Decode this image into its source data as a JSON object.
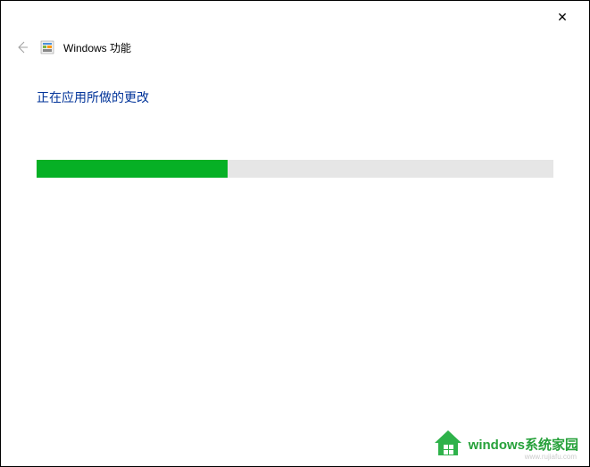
{
  "titlebar": {
    "close_symbol": "✕"
  },
  "header": {
    "title": "Windows 功能"
  },
  "content": {
    "status_heading": "正在应用所做的更改",
    "progress_percent": 37
  },
  "watermark": {
    "text": "windows系统家园",
    "url": "www.rujiafu.com"
  }
}
